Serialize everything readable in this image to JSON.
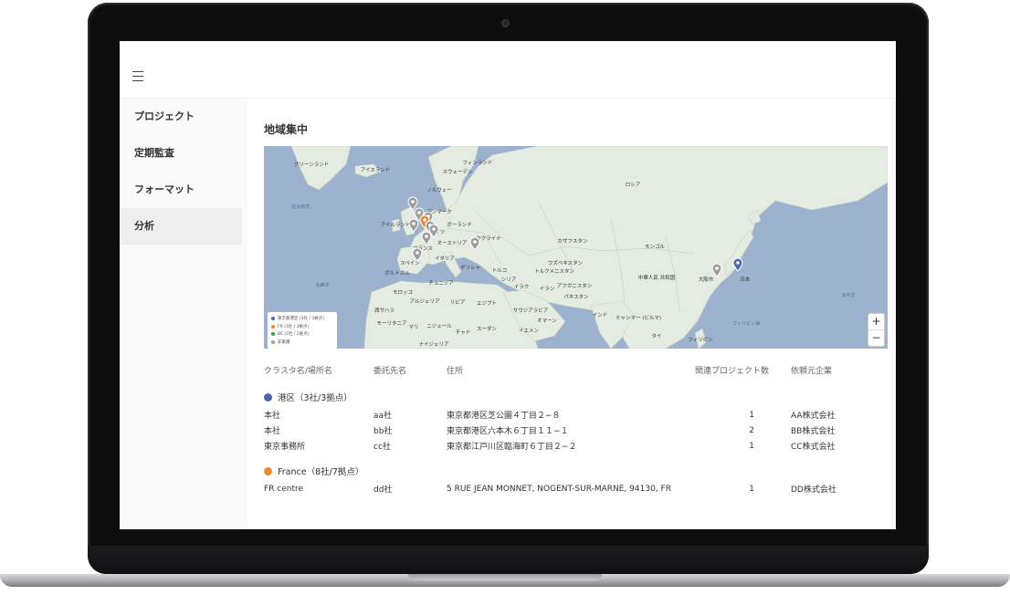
{
  "nav": {
    "items": [
      {
        "label": "プロジェクト"
      },
      {
        "label": "定期監査"
      },
      {
        "label": "フォーマット"
      },
      {
        "label": "分析"
      }
    ],
    "active_index": 3
  },
  "section_title": "地域集中",
  "map": {
    "labels": {
      "greenland": "グリーンランド",
      "iceland": "アイスランド",
      "sweden": "スウェーデン",
      "finland": "フィンランド",
      "norway": "ノルウェー",
      "denmark": "デンマーク",
      "ireland": "アイルランド",
      "poland": "ポーランド",
      "germany": "ドイツ",
      "france": "フランス",
      "austria": "オーストリア",
      "ukraine": "ウクライナ",
      "spain": "スペイン",
      "portugal": "ポルトガル",
      "italy": "イタリア",
      "greece": "ギリシャ",
      "turkey": "トルコ",
      "russia": "ロシア",
      "kazakhstan": "カザフスタン",
      "mongolia": "モンゴル",
      "uzbekistan": "ウズベキスタン",
      "turkmenistan": "トルクメニスタン",
      "afghanistan": "アフガニスタン",
      "pakistan": "パキスタン",
      "iran": "イラン",
      "iraq": "イラク",
      "syria": "シリア",
      "china": "中華人民\n共和国",
      "japan": "日本",
      "osaka": "大阪市",
      "morocco": "モロッコ",
      "algeria": "アルジェリア",
      "tunisia": "チュニジア",
      "libya": "リビア",
      "egypt": "エジプト",
      "saudi": "サウジアラビア",
      "oman": "オマーン",
      "yemen": "イエメン",
      "sudan": "スーダン",
      "chad": "チャド",
      "niger": "ニジェール",
      "nigeria": "ナイジェリア",
      "mali": "マリ",
      "mauritania": "モーリタニア",
      "western_sahara": "西サハラ",
      "india": "インド",
      "myanmar": "ミャンマー\n(ビルマ)",
      "thailand": "タイ",
      "philippines": "フィリピン",
      "atlantic": "大西洋",
      "pacific": "太平洋",
      "north_atlantic": "北大西洋",
      "philippine_sea": "フィリピン海"
    },
    "legend": [
      {
        "label": "東京都港区 (3社 / 3拠点)",
        "color": "#4a6aa5"
      },
      {
        "label": "FR (3社 / 3拠点)",
        "color": "#e88a2c"
      },
      {
        "label": "BE (2社 / 2拠点)",
        "color": "#3a9b4a"
      },
      {
        "label": "非集積",
        "color": "#9e9e9e"
      }
    ],
    "zoom_in": "+",
    "zoom_out": "−"
  },
  "table": {
    "headers": [
      "クラスタ名/場所名",
      "委託先名",
      "住所",
      "関連プロジェクト数",
      "依頼元企業"
    ],
    "clusters": [
      {
        "name": "港区（3社/3拠点）",
        "color": "#4a6aa5",
        "rows": [
          {
            "place": "本社",
            "contractor": "aa社",
            "address": "東京都港区芝公園４丁目２−８",
            "count": "1",
            "client": "AA株式会社"
          },
          {
            "place": "本社",
            "contractor": "bb社",
            "address": "東京都港区六本木６丁目１１−１",
            "count": "2",
            "client": "BB株式会社"
          },
          {
            "place": "東京事務所",
            "contractor": "cc社",
            "address": "東京都江戸川区臨海町６丁目２−２",
            "count": "1",
            "client": "CC株式会社"
          }
        ]
      },
      {
        "name": "France（8社/7拠点）",
        "color": "#e88a2c",
        "rows": [
          {
            "place": "FR centre",
            "contractor": "dd社",
            "address": "5 RUE JEAN MONNET, NOGENT-SUR-MARNE, 94130, FR",
            "count": "1",
            "client": "DD株式会社"
          }
        ]
      }
    ]
  }
}
